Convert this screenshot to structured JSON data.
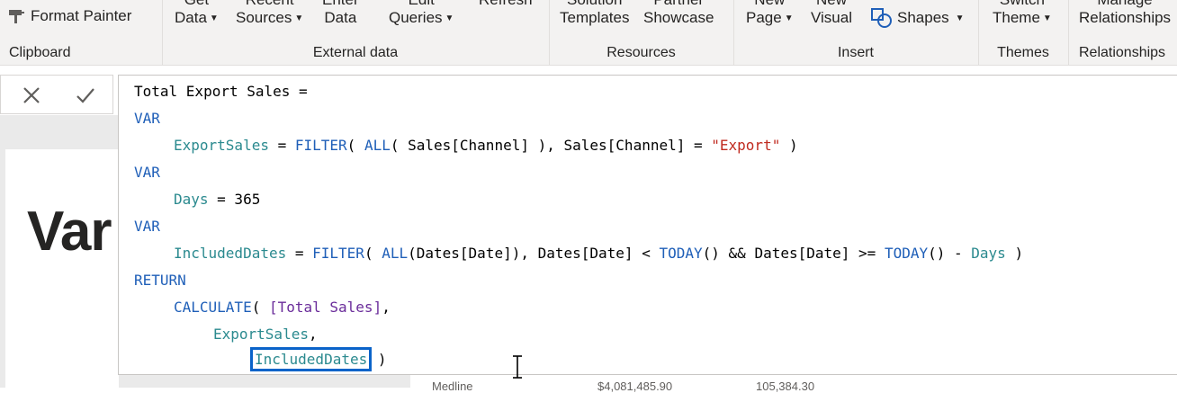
{
  "ribbon": {
    "clipboard": {
      "format_painter": "Format Painter",
      "label": "Clipboard"
    },
    "external_data": {
      "label": "External data",
      "get_data": [
        "Get",
        "Data"
      ],
      "recent_sources": [
        "Recent",
        "Sources"
      ],
      "enter_data": [
        "Enter",
        "Data"
      ],
      "edit_queries": [
        "Edit",
        "Queries"
      ],
      "refresh": "Refresh"
    },
    "resources": {
      "label": "Resources",
      "solution_templates": [
        "Solution",
        "Templates"
      ],
      "partner_showcase": [
        "Partner",
        "Showcase"
      ]
    },
    "insert": {
      "label": "Insert",
      "new_page": [
        "New",
        "Page"
      ],
      "new_visual": [
        "New",
        "Visual"
      ],
      "shapes": "Shapes"
    },
    "themes": {
      "label": "Themes",
      "switch_theme": [
        "Switch",
        "Theme"
      ]
    },
    "relationships": {
      "label": "Relationships",
      "manage": [
        "Manage",
        "Relationships"
      ]
    }
  },
  "canvas": {
    "title_partial": "Var",
    "table_row": [
      "Medline",
      "$4,081,485.90",
      "105,384.30"
    ]
  },
  "formula": {
    "measure_name": "Total Export Sales =",
    "kw_var": "VAR",
    "kw_return": "RETURN",
    "line_export": {
      "name": "ExportSales",
      "eq": " = ",
      "filter": "FILTER",
      "p1": "( ",
      "all": "ALL",
      "p2": "( Sales[Channel] ), Sales[Channel] = ",
      "str": "\"Export\"",
      "p3": " )"
    },
    "line_days": {
      "name": "Days",
      "rest": " = 365"
    },
    "line_dates": {
      "name": "IncludedDates",
      "eq": " = ",
      "filter": "FILTER",
      "p1": "( ",
      "all": "ALL",
      "p2": "(Dates[Date]), Dates[Date] < ",
      "today1": "TODAY",
      "p3": "() && Dates[Date] >= ",
      "today2": "TODAY",
      "p4": "() - ",
      "days": "Days",
      "p5": " )"
    },
    "line_calc": {
      "fn": "CALCULATE",
      "p1": "( ",
      "measure": "[Total Sales]",
      "p2": ","
    },
    "line_exp_arg": {
      "name": "ExportSales",
      "p": ","
    },
    "line_dates_arg": {
      "name": "IncludedDates",
      "p": " )"
    }
  },
  "colors": {
    "keyword": "#1f5fb8",
    "variable": "#2b8a8f",
    "string": "#c02a1f",
    "measure": "#6a2c9a",
    "highlight": "#0a63c9"
  }
}
